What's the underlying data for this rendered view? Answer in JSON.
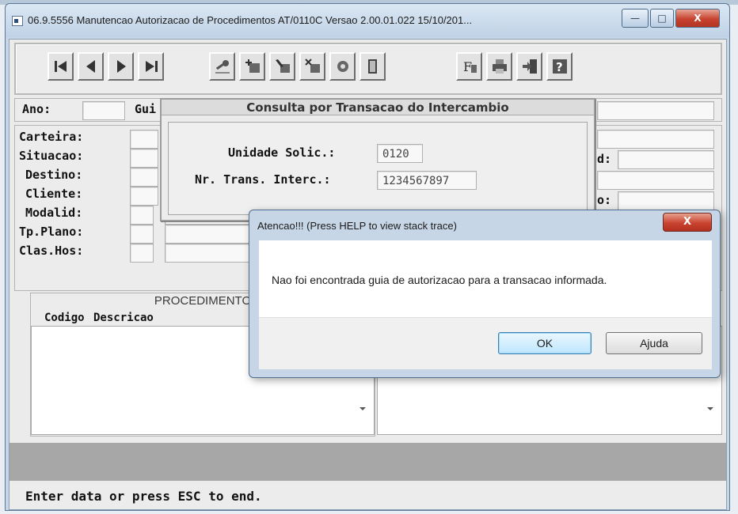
{
  "window": {
    "title": "06.9.5556 Manutencao Autorizacao de Procedimentos AT/0110C Versao 2.00.01.022 15/10/201...",
    "controls": [
      "—",
      "□",
      "X"
    ]
  },
  "toolbar": {
    "buttons": [
      "first-record",
      "previous-record",
      "next-record",
      "last-record",
      "search",
      "add",
      "edit",
      "delete",
      "copy",
      "exit-door",
      "filter",
      "print",
      "open",
      "help"
    ],
    "filter_glyph": "F"
  },
  "header_fields": {
    "ano_label": "Ano:",
    "guia_label": "Gui"
  },
  "left_fields": [
    "Carteira:",
    "Situacao:",
    "Destino:",
    "Cliente:",
    "Modalid:",
    "Tp.Plano:",
    "Clas.Hos:"
  ],
  "right_fields": {
    "label_1": "d:",
    "label_2": "o:"
  },
  "procedimentos": {
    "title": "PROCEDIMENTO",
    "col_codigo": "Codigo",
    "col_descricao": "Descricao"
  },
  "consulta": {
    "title": "Consulta por Transacao do Intercambio",
    "unidade_label": "Unidade Solic.:",
    "unidade_value": "0120",
    "nr_trans_label": "Nr. Trans. Interc.:",
    "nr_trans_value": "1234567897"
  },
  "alert": {
    "title": "Atencao!!! (Press HELP to view stack trace)",
    "close": "X",
    "message": "Nao foi encontrada guia de autorizacao para a transacao informada.",
    "ok_label": "OK",
    "help_label": "Ajuda"
  },
  "status": {
    "text": "Enter data or press ESC to end."
  }
}
